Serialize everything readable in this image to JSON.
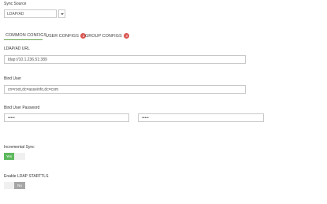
{
  "sync_source": {
    "label": "Sync Source",
    "value": "LDAP/AD"
  },
  "tabs": [
    {
      "label": "COMMON CONFIGS",
      "active": true
    },
    {
      "label": "USER CONFIGS",
      "badge": "3"
    },
    {
      "label": "GROUP CONFIGS",
      "badge": "3"
    }
  ],
  "ldap_url": {
    "label": "LDAP/AD URL",
    "value": "ldap://10.1.236.51:389"
  },
  "bind_user": {
    "label": "Bind User",
    "value": "cn=root,dc=asseinfo,dc=com"
  },
  "bind_password": {
    "label": "Bind User Password",
    "value": "•••••",
    "confirm_value": "•••••"
  },
  "incremental_sync": {
    "label": "Incremental Sync",
    "state_label": "Yes"
  },
  "starttls": {
    "label": "Enable LDAP STARTTLS",
    "state_label": "No"
  },
  "colors": {
    "accent": "#6aa84f",
    "badge": "#d9534f",
    "toggle_on": "#5cb85c",
    "toggle_no": "#a6a6a6"
  }
}
